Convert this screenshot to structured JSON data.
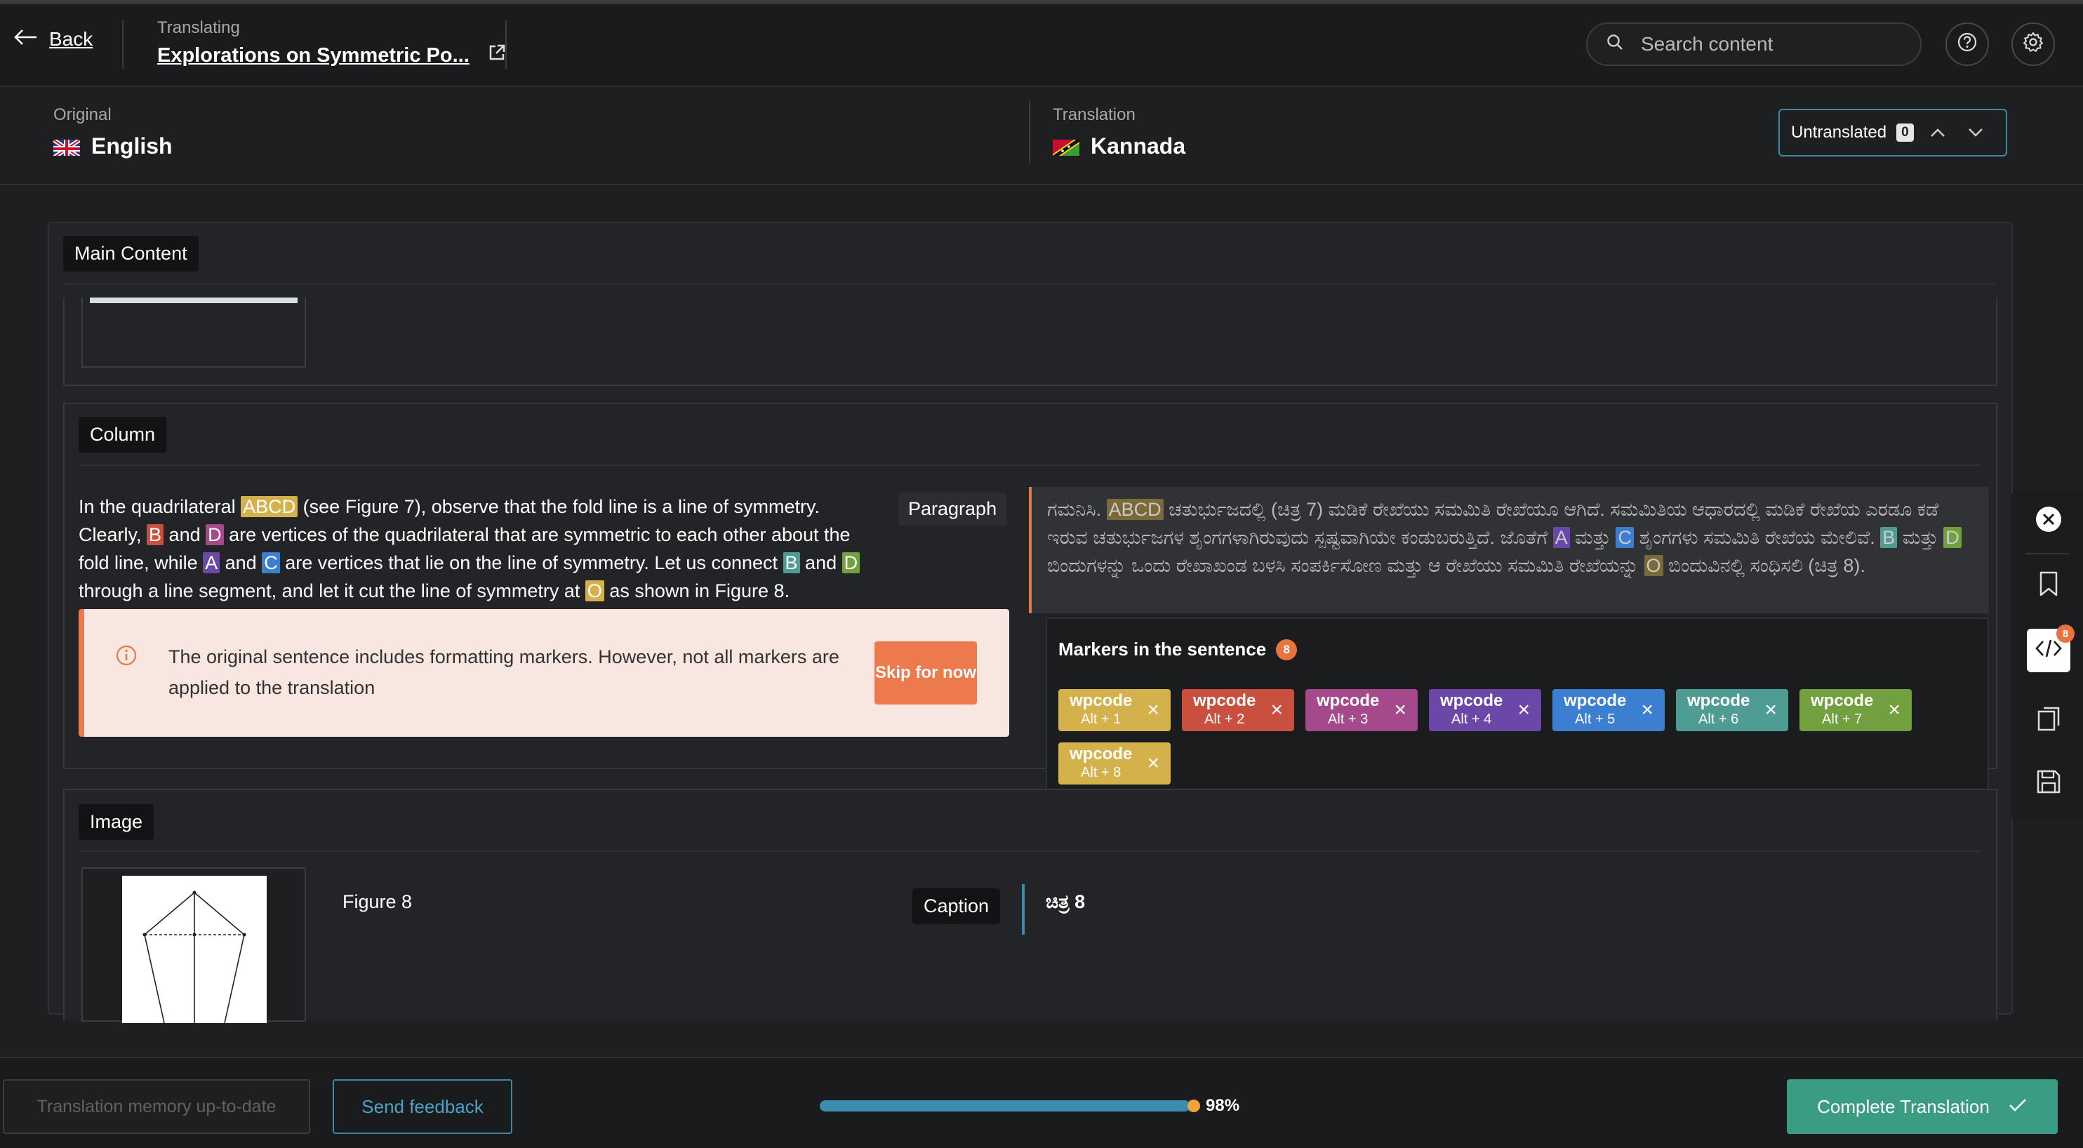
{
  "header": {
    "back_label": "Back",
    "crumb_label": "Translating",
    "page_title": "Explorations on Symmetric Po...",
    "search_placeholder": "Search content"
  },
  "languages": {
    "original_caption": "Original",
    "original_name": "English",
    "translation_caption": "Translation",
    "translation_name": "Kannada",
    "untranslated_label": "Untranslated",
    "untranslated_count": "0"
  },
  "sections": {
    "main_content": "Main Content",
    "column": "Column",
    "image": "Image",
    "paragraph": "Paragraph",
    "caption": "Caption"
  },
  "paragraph_en": {
    "t1": "In the quadrilateral ",
    "m1": "ABCD",
    "t2": " (see Figure 7), observe that the fold line is a line of symmetry. Clearly, ",
    "m2": "B",
    "t3": " and ",
    "m3": "D",
    "t4": " are vertices of the quadrilateral that are symmetric to each other about the fold line, while ",
    "m4": "A",
    "t5": " and ",
    "m5": "C",
    "t6": " are vertices that lie on the line of symmetry. Let us connect ",
    "m6": "B",
    "t7": " and ",
    "m7": "D",
    "t8": " through a line segment, and let it cut the line of symmetry at ",
    "m8": "O",
    "t9": " as shown in Figure 8."
  },
  "paragraph_kn": {
    "t1": "ಗಮನಿಸಿ. ",
    "m1": "ABCD",
    "t2": " ಚತುರ್ಭುಜದಲ್ಲಿ (ಚಿತ್ರ 7) ಮಡಿಕೆ ರೇಖೆಯು ಸಮಮಿತಿ ರೇಖೆಯೂ ಆಗಿದೆ. ಸಮಮಿತಿಯ ಆಧಾರದಲ್ಲಿ ಮಡಿಕೆ ರೇಖೆಯ ಎರಡೂ ಕಡೆ ಇರುವ ಚತುರ್ಭುಜಗಳ ಶೃಂಗಗಳಾಗಿರುವುದು ಸ್ಪಷ್ಟವಾಗಿಯೇ ಕಂಡುಬರುತ್ತಿದೆ. ಜೊತೆಗೆ ",
    "m4": "A",
    "t3": " ಮತ್ತು ",
    "m5": "C",
    "t4": " ಶೃಂಗಗಳು ಸಮಮಿತಿ ರೇಖೆಯ ಮೇಲಿವೆ. ",
    "m6": "B",
    "t5": " ಮತ್ತು ",
    "m7": "D",
    "t6": " ಬಿಂದುಗಳನ್ನು ಒಂದು ರೇಖಾಖಂಡ ಬಳಸಿ ಸಂಪರ್ಕಿಸೋಣ ಮತ್ತು ಆ ರೇಖೆಯು ಸಮಮಿತಿ ರೇಖೆಯನ್ನು ",
    "m8": "O",
    "t7": " ಬಿಂದುವಿನಲ್ಲಿ ಸಂಧಿಸಲಿ (ಚಿತ್ರ 8)."
  },
  "notice": {
    "text": "The original sentence includes formatting markers. However, not all markers are applied to the translation",
    "skip_label": "Skip for now"
  },
  "markers": {
    "title": "Markers in the sentence",
    "count": "8",
    "tool_badge": "8",
    "items": [
      {
        "name": "wpcode",
        "shortcut": "Alt + 1",
        "color": "#d4b14a"
      },
      {
        "name": "wpcode",
        "shortcut": "Alt + 2",
        "color": "#c9503e"
      },
      {
        "name": "wpcode",
        "shortcut": "Alt + 3",
        "color": "#a4498c"
      },
      {
        "name": "wpcode",
        "shortcut": "Alt + 4",
        "color": "#6b47a8"
      },
      {
        "name": "wpcode",
        "shortcut": "Alt + 5",
        "color": "#3c7fd1"
      },
      {
        "name": "wpcode",
        "shortcut": "Alt + 6",
        "color": "#4f9c94"
      },
      {
        "name": "wpcode",
        "shortcut": "Alt + 7",
        "color": "#72a03e"
      },
      {
        "name": "wpcode",
        "shortcut": "Alt + 8",
        "color": "#d4b14a"
      }
    ]
  },
  "figure": {
    "original_caption": "Figure 8",
    "translated_caption": "ಚಿತ್ರ 8"
  },
  "footer": {
    "tm_label": "Translation memory up-to-date",
    "feedback_label": "Send feedback",
    "progress_fraction": 0.98,
    "progress_label": "98%",
    "complete_label": "Complete Translation"
  },
  "colors": {
    "accent": "#3f88a8",
    "complete": "#3b9c84",
    "warning": "#ec7a4c"
  }
}
